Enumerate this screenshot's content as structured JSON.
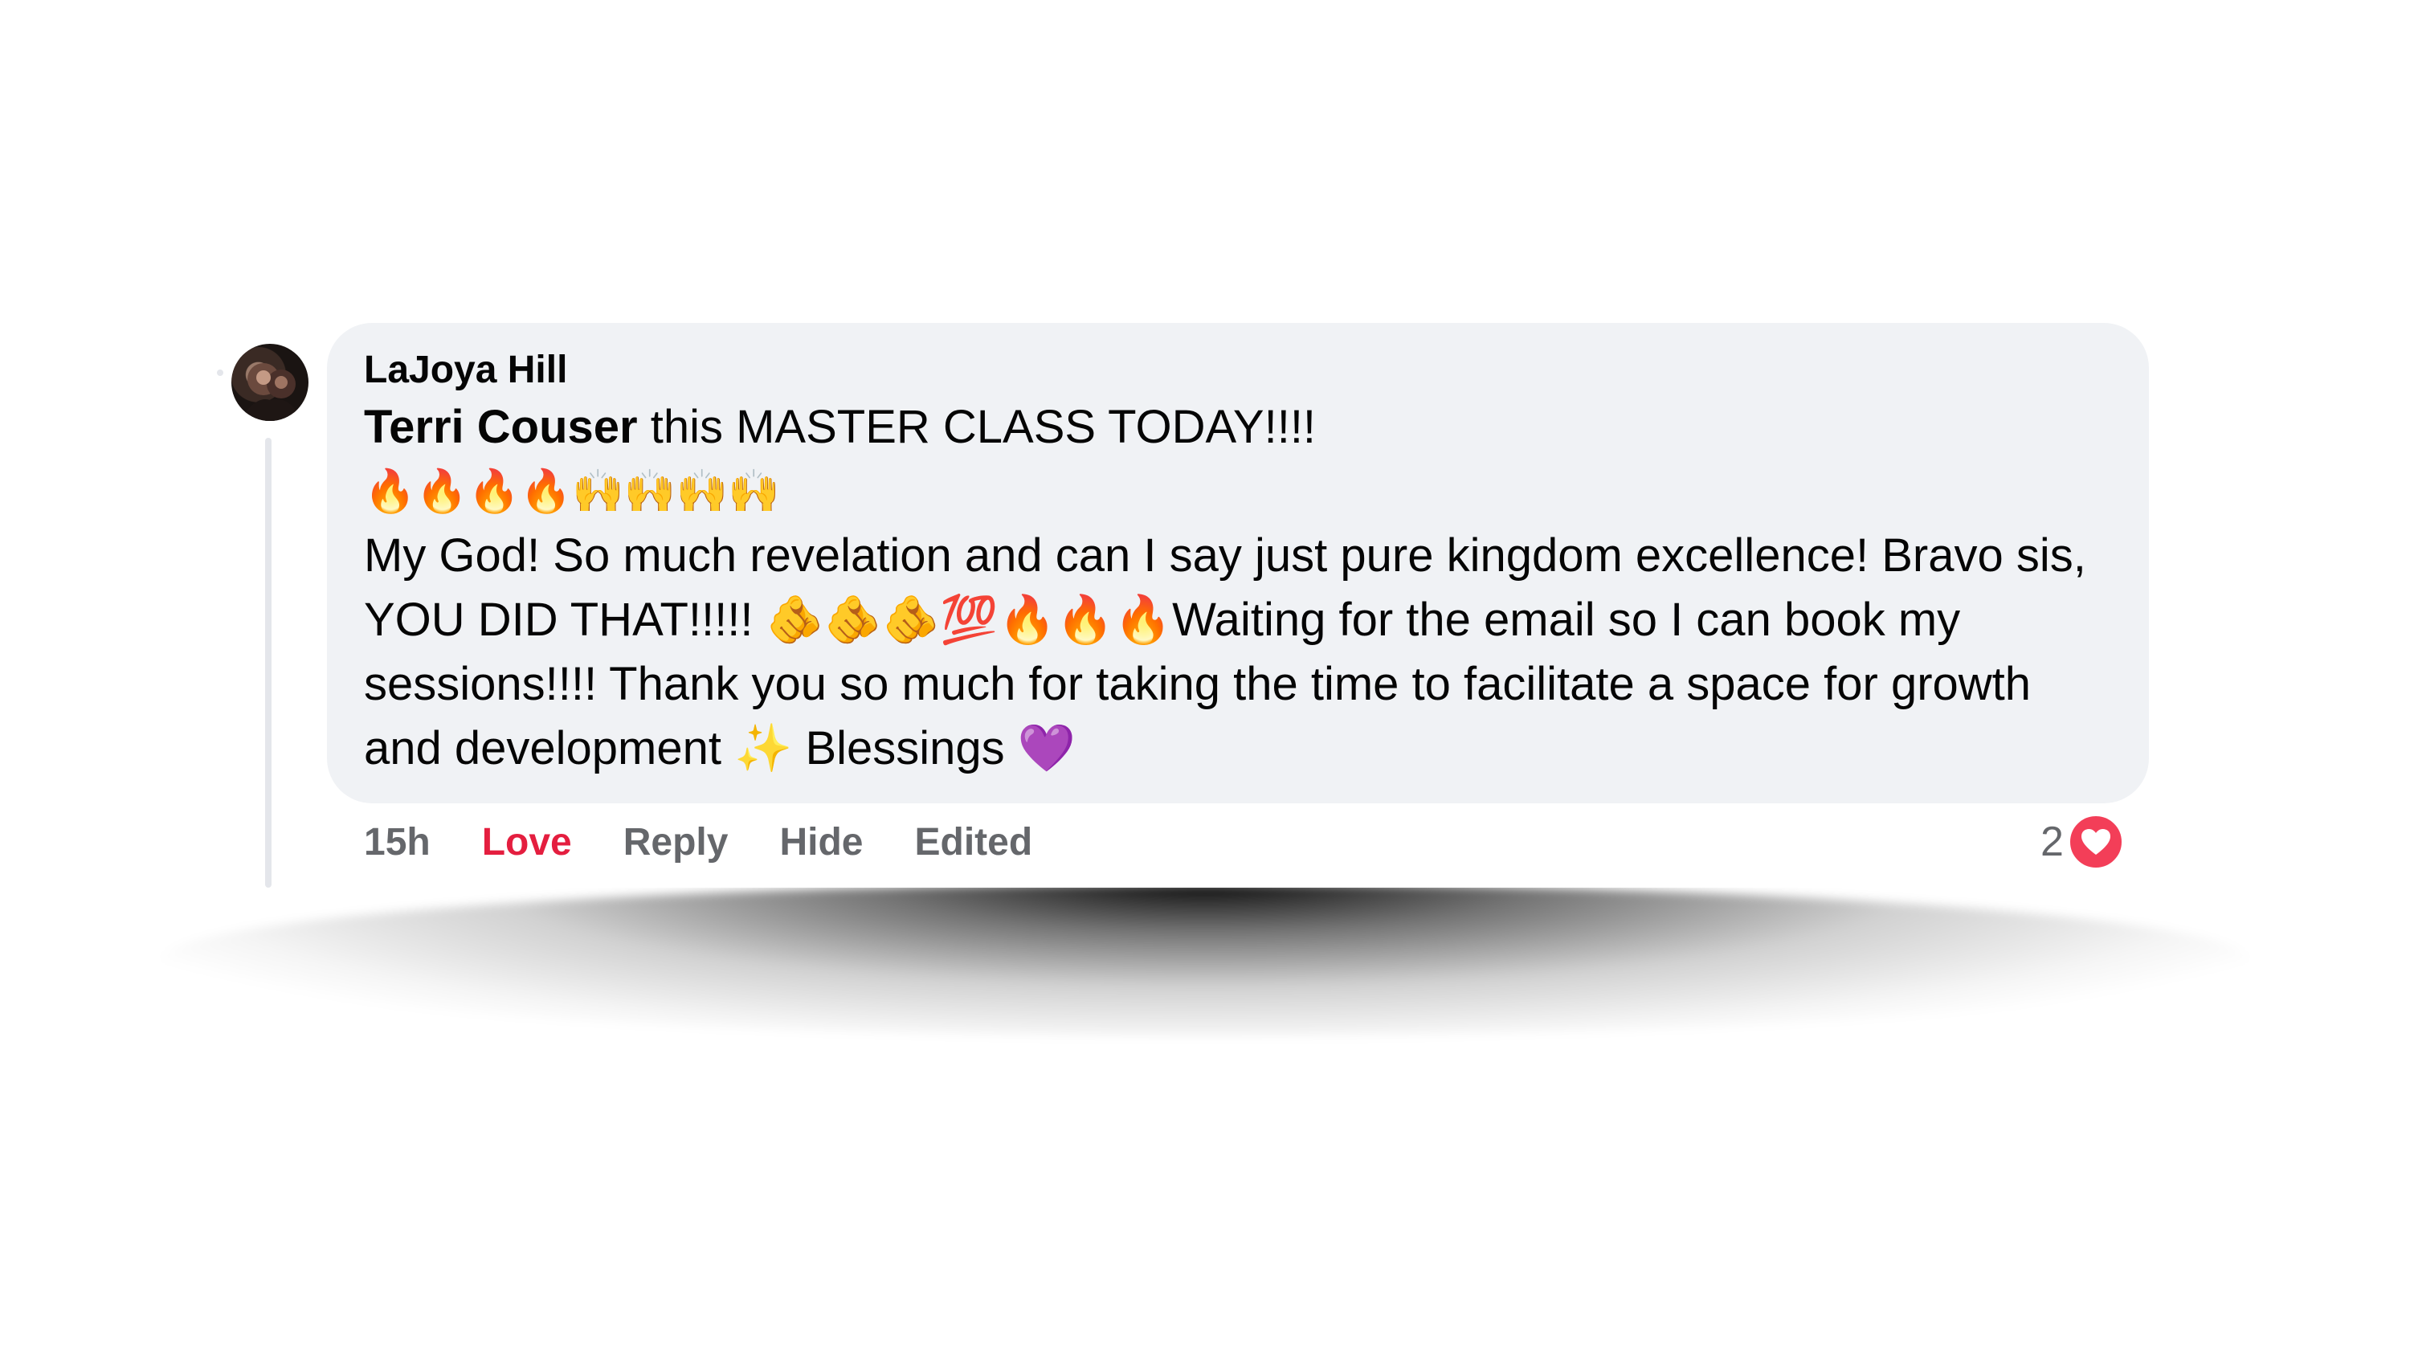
{
  "comment": {
    "author": "LaJoya Hill",
    "mention": "Terri Couser",
    "line1_rest": " this MASTER CLASS TODAY!!!!",
    "emoji_line": {
      "fires": [
        "🔥",
        "🔥",
        "🔥",
        "🔥"
      ],
      "hands": [
        "🙌",
        "🙌",
        "🙌",
        "🙌"
      ]
    },
    "para_1": "My God! So much revelation and can I say just pure kingdom excellence! Bravo sis, YOU DID THAT!!!!! ",
    "para_emojis": {
      "pointing": [
        "🫵",
        "🫵",
        "🫵"
      ],
      "hundred": "💯",
      "fires": [
        "🔥",
        "🔥",
        "🔥"
      ]
    },
    "para_2": "Waiting for the email so I can book my sessions!!!! Thank you so much for taking the time to facilitate a space for growth and development ",
    "sparkle": "✨",
    "para_3": " Blessings ",
    "purple_heart": "💜"
  },
  "actions": {
    "time": "15h",
    "love": "Love",
    "reply": "Reply",
    "hide": "Hide",
    "edited": "Edited"
  },
  "reactions": {
    "count": "2",
    "type": "love",
    "color": "#f33e58"
  },
  "colors": {
    "bubble": "#f0f2f5",
    "love_active": "#e41e3f",
    "muted_text": "#65676b"
  }
}
